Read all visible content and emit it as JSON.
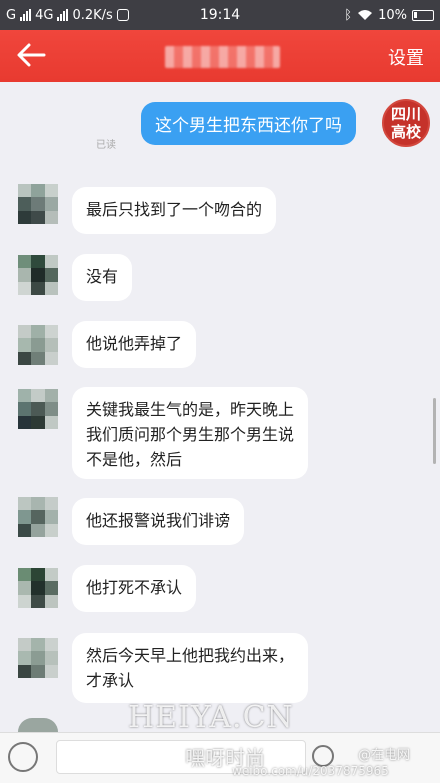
{
  "status_bar": {
    "carrier_left": "G",
    "network": "4G",
    "speed": "0.2K/s",
    "time": "19:14",
    "battery": "10%"
  },
  "header": {
    "back_icon": "back-arrow-icon",
    "settings_label": "设置"
  },
  "sent_message": {
    "text": "这个男生把东西还你了吗",
    "read_label": "已读",
    "avatar_text": [
      "四",
      "川",
      "高",
      "校"
    ],
    "avatar_color": "#c5322a"
  },
  "received_messages": [
    {
      "lines": [
        "最后只找到了一个吻合的"
      ]
    },
    {
      "lines": [
        "没有"
      ]
    },
    {
      "lines": [
        "他说他弄掉了"
      ]
    },
    {
      "lines": [
        "关键我最生气的是，昨天晚上",
        "我们质问那个男生那个男生说",
        "不是他，然后"
      ]
    },
    {
      "lines": [
        "他还报警说我们诽谤"
      ]
    },
    {
      "lines": [
        "他打死不承认"
      ]
    },
    {
      "lines": [
        "然后今天早上他把我约出来，",
        "才承认"
      ]
    }
  ],
  "watermarks": {
    "site": "HEIYA.CN",
    "brand": "嘿呀时尚",
    "source_badge": "@在电网",
    "url": "weibo.com/u/2037875965"
  },
  "colors": {
    "header": "#ea3d33",
    "sent_bubble": "#3aa0f2",
    "status_bar": "#3e3e44"
  }
}
